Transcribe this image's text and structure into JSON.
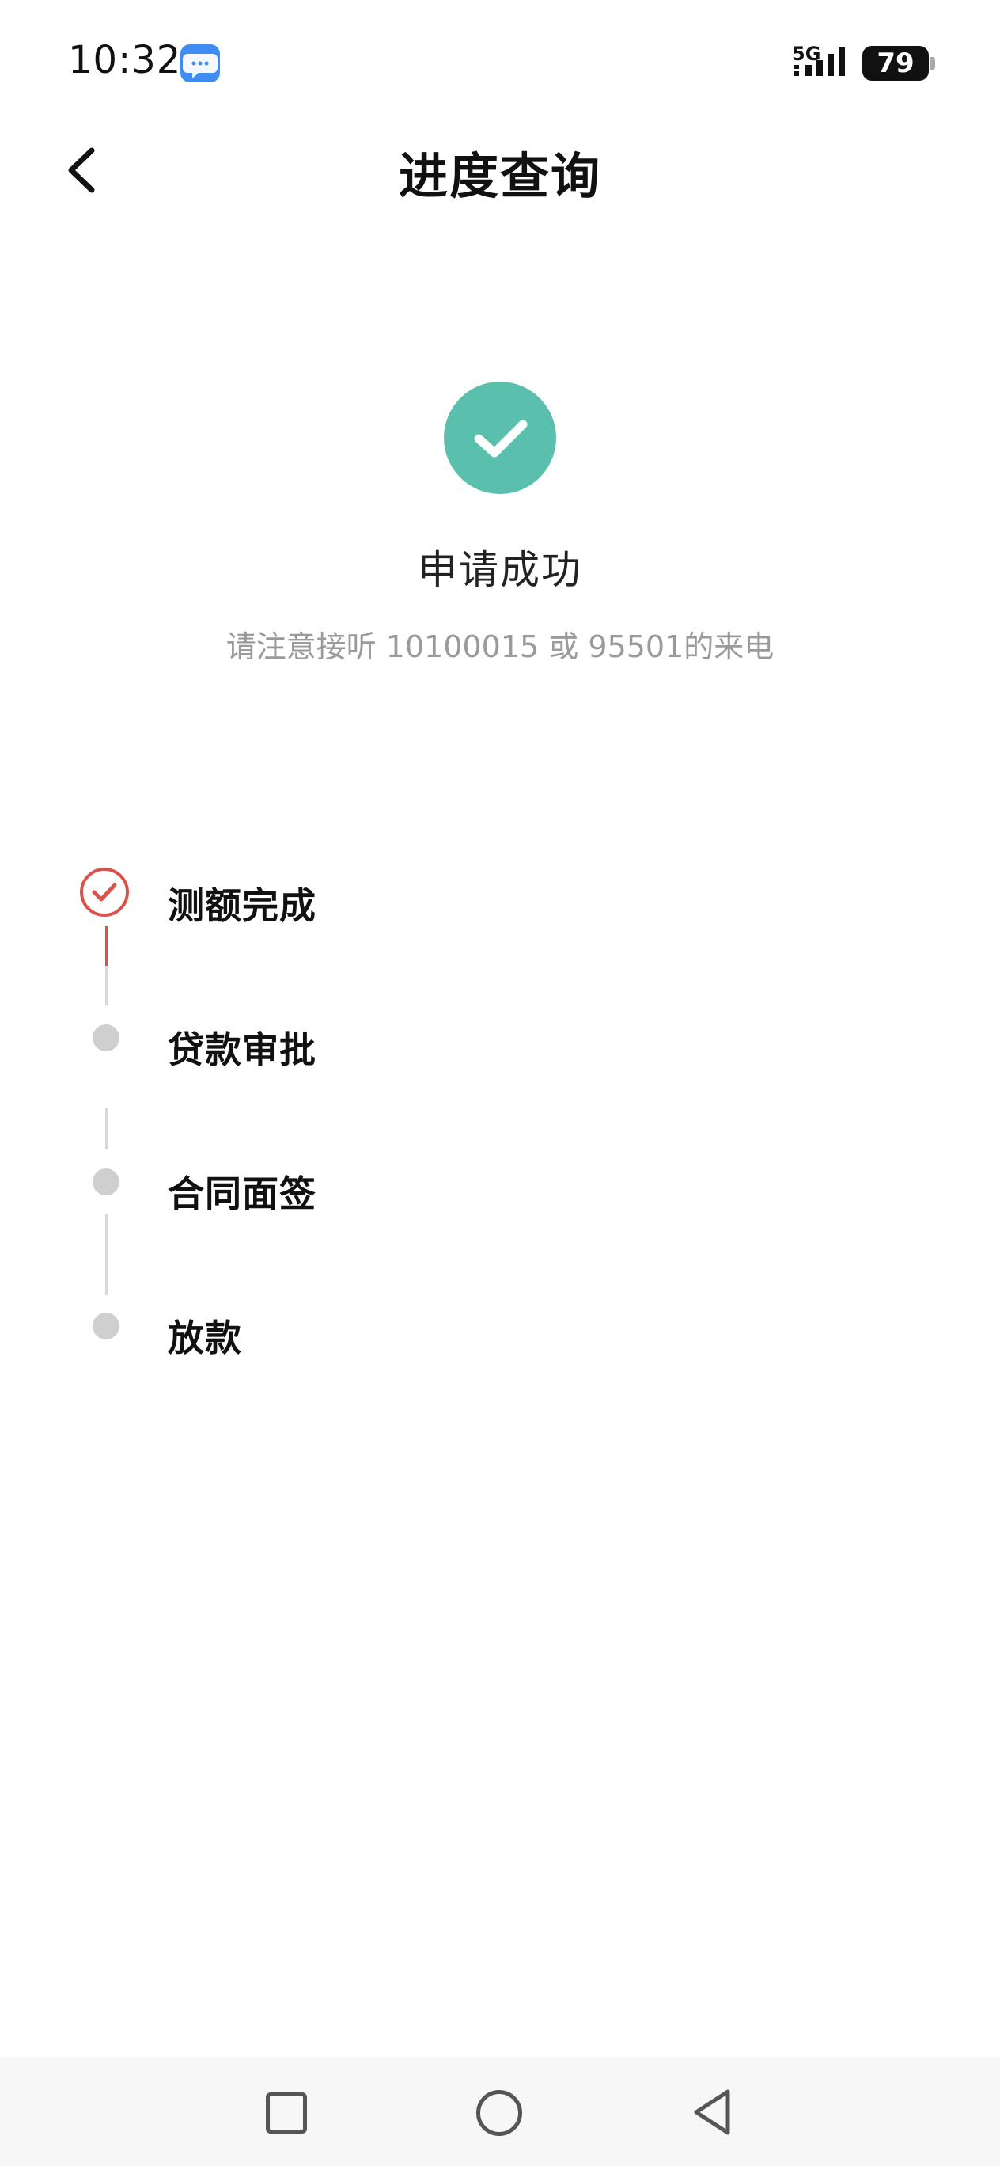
{
  "status_bar": {
    "time": "10:32",
    "network": "5G",
    "battery": "79",
    "notification_icon": "message-bubble-icon"
  },
  "header": {
    "back_icon": "chevron-left-icon",
    "title": "进度查询"
  },
  "result": {
    "icon": "check-circle-icon",
    "title": "申请成功",
    "subtitle": "请注意接听 10100015 或 95501的来电",
    "icon_color": "#5bbfae"
  },
  "timeline": {
    "steps": [
      {
        "label": "测额完成",
        "status": "done"
      },
      {
        "label": "贷款审批",
        "status": "pending"
      },
      {
        "label": "合同面签",
        "status": "pending"
      },
      {
        "label": "放款",
        "status": "pending"
      }
    ],
    "done_color": "#d9534a",
    "pending_color": "#cfcfcf"
  },
  "system_nav": {
    "recents_icon": "square-recents-icon",
    "home_icon": "circle-home-icon",
    "back_icon": "triangle-back-icon"
  }
}
